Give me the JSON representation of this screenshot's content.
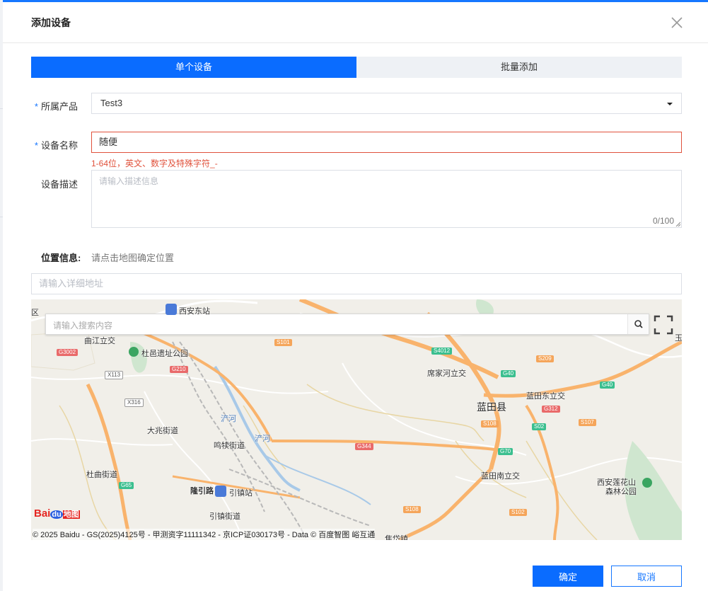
{
  "dialog": {
    "title": "添加设备",
    "tabs": [
      {
        "label": "单个设备",
        "active": true
      },
      {
        "label": "批量添加",
        "active": false
      }
    ]
  },
  "form": {
    "product": {
      "required_mark": "*",
      "label": "所属产品",
      "value": "Test3"
    },
    "device_name": {
      "required_mark": "*",
      "label": "设备名称",
      "value": "随便",
      "error": "1-64位，英文、数字及特殊字符_-"
    },
    "description": {
      "label": "设备描述",
      "placeholder": "请输入描述信息",
      "counter": "0/100"
    },
    "location": {
      "label": "位置信息:",
      "hint": "请点击地图确定位置"
    },
    "address": {
      "placeholder": "请输入详细地址"
    }
  },
  "map": {
    "search_placeholder": "请输入搜索内容",
    "places": {
      "p1": "西安东站",
      "p2": "曲江立交",
      "p3": "杜邑遗址公园",
      "p4": "席家河立交",
      "p5": "蓝田东立交",
      "p6": "蓝田县",
      "p7": "大兆街道",
      "p8": "鸣犊街道",
      "p9": "杜曲街道",
      "p10": "引镇站",
      "p11": "引镇街道",
      "p12": "蓝田南立交",
      "p13": "西安莲花山",
      "p14": "森林公园",
      "p15": "浐河",
      "p16": "浐河",
      "p17": "焦岱镇",
      "p18": "区",
      "p19": "玉",
      "p20": "隆引路"
    },
    "roads": {
      "r1": "G3002",
      "r2": "X113",
      "r3": "X316",
      "r4": "G210",
      "r5": "S101",
      "r6": "S4012",
      "r7": "S209",
      "r8": "G40",
      "r9": "G40",
      "r10": "G312",
      "r11": "S108",
      "r12": "S02",
      "r13": "S107",
      "r14": "G344",
      "r15": "G70",
      "r16": "G65",
      "r17": "S108",
      "r18": "S102"
    },
    "logo": {
      "bai": "Bai",
      "du": "du",
      "ditu": "地图"
    },
    "copyright": "© 2025 Baidu - GS(2025)4125号 - 甲测资字11111342 - 京ICP证030173号 - Data © 百度智图 峪互通"
  },
  "footer": {
    "confirm": "确定",
    "cancel": "取消"
  },
  "colors": {
    "primary": "#0a6cff",
    "error": "#e0523c",
    "tab_inactive": "#eef1f5"
  }
}
